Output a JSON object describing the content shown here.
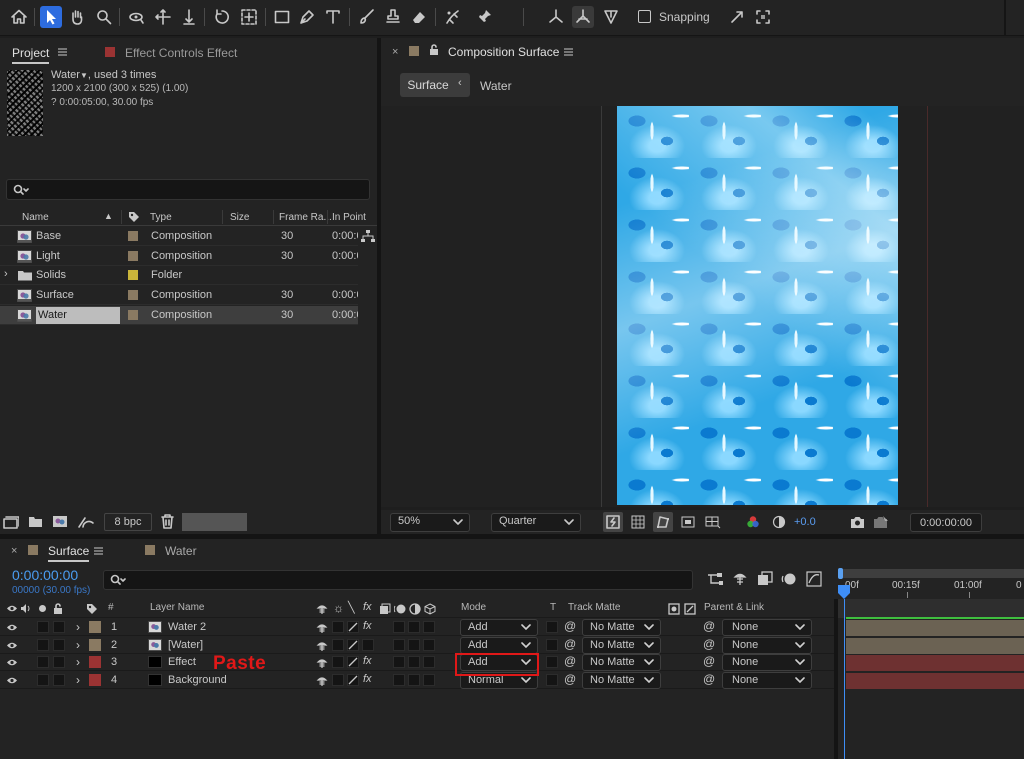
{
  "toolbar": {
    "tools": [
      "home-icon",
      "selection-icon",
      "hand-icon",
      "zoom-icon",
      "orbit-icon",
      "pan-icon",
      "dolly-icon",
      "rotate-icon",
      "pan-behind-icon",
      "rectangle-icon",
      "pen-icon",
      "type-icon",
      "brush-icon",
      "clone-stamp-icon",
      "eraser-icon",
      "roto-brush-icon",
      "puppet-pin-icon"
    ],
    "snapping_label": "Snapping"
  },
  "project_panel": {
    "tab_label": "Project",
    "effect_controls_label": "Effect Controls Effect",
    "item_name": "Water",
    "item_used": ", used 3 times",
    "item_dims": "1200 x 2100  (300 x 525) (1.00)",
    "item_duration": "? 0:00:05:00, 30.00 fps",
    "search_placeholder": "",
    "columns": {
      "name": "Name",
      "type": "Type",
      "size": "Size",
      "frame_rate": "Frame Ra...",
      "in_point": "In Point"
    },
    "items": [
      {
        "name": "Base",
        "type": "Composition",
        "frame_rate": "30",
        "in_point": "0:00:0",
        "color": "#8a7a62",
        "kind": "comp"
      },
      {
        "name": "Light",
        "type": "Composition",
        "frame_rate": "30",
        "in_point": "0:00:0",
        "color": "#8a7a62",
        "kind": "comp"
      },
      {
        "name": "Solids",
        "type": "Folder",
        "frame_rate": "",
        "in_point": "",
        "color": "#c9b53a",
        "kind": "folder"
      },
      {
        "name": "Surface",
        "type": "Composition",
        "frame_rate": "30",
        "in_point": "0:00:0",
        "color": "#8a7a62",
        "kind": "comp"
      },
      {
        "name": "Water",
        "type": "Composition",
        "frame_rate": "30",
        "in_point": "0:00:0",
        "color": "#8a7a62",
        "kind": "comp",
        "selected": true
      }
    ],
    "bpc_label": "8 bpc"
  },
  "composition_panel": {
    "tab_label": "Composition Surface",
    "breadcrumb_active": "Surface",
    "breadcrumb_next": "Water",
    "zoom": "50%",
    "resolution": "Quarter",
    "exposure": "+0.0",
    "timecode": "0:00:00:00"
  },
  "timeline": {
    "tab_active": "Surface",
    "tab_other": "Water",
    "timecode": "0:00:00:00",
    "frame_info": "00000 (30.00 fps)",
    "columns": {
      "num": "#",
      "layer_name": "Layer Name",
      "mode": "Mode",
      "t": "T",
      "track_matte": "Track Matte",
      "parent": "Parent & Link"
    },
    "ruler_labels": [
      "00f",
      "00:15f",
      "01:00f",
      "0"
    ],
    "layers": [
      {
        "num": "1",
        "name": "Water 2",
        "mode": "Add",
        "track_matte": "No Matte",
        "parent": "None",
        "color": "#8a7a62",
        "source": "comp",
        "fx": true
      },
      {
        "num": "2",
        "name": "[Water]",
        "mode": "Add",
        "track_matte": "No Matte",
        "parent": "None",
        "color": "#8a7a62",
        "source": "comp",
        "fx": false
      },
      {
        "num": "3",
        "name": "Effect",
        "mode": "Add",
        "track_matte": "No Matte",
        "parent": "None",
        "color": "#9b3333",
        "source": "solid",
        "fx": true
      },
      {
        "num": "4",
        "name": "Background",
        "mode": "Normal",
        "track_matte": "No Matte",
        "parent": "None",
        "color": "#9b3333",
        "source": "solid",
        "fx": true
      }
    ],
    "annotation": "Paste"
  }
}
